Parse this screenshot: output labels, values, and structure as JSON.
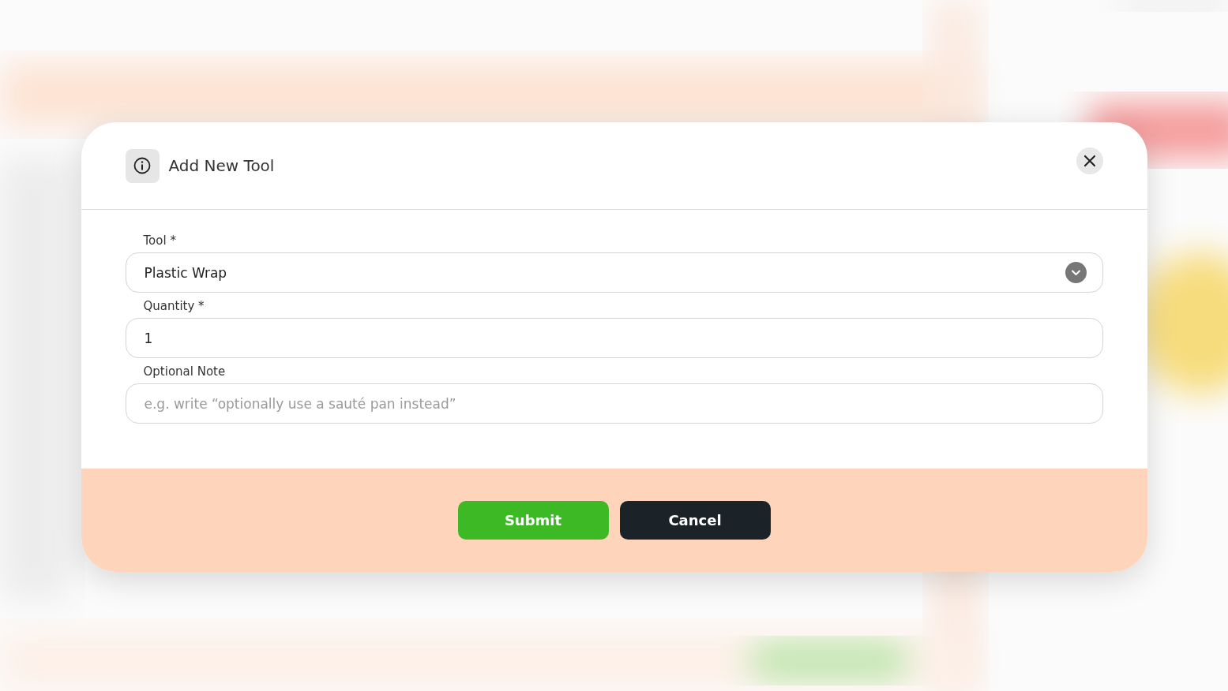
{
  "dialog": {
    "title": "Add New Tool"
  },
  "fields": [
    {
      "kind": "select",
      "label": "Tool *",
      "value": "Plastic Wrap"
    },
    {
      "kind": "input",
      "label": "Quantity *",
      "value": "1"
    },
    {
      "kind": "input",
      "label": "Optional Note",
      "placeholder": "e.g. write “optionally use a sauté pan instead”"
    }
  ],
  "buttons": [
    {
      "kind": "primary",
      "label": "Submit"
    },
    {
      "kind": "dark",
      "label": "Cancel"
    }
  ]
}
